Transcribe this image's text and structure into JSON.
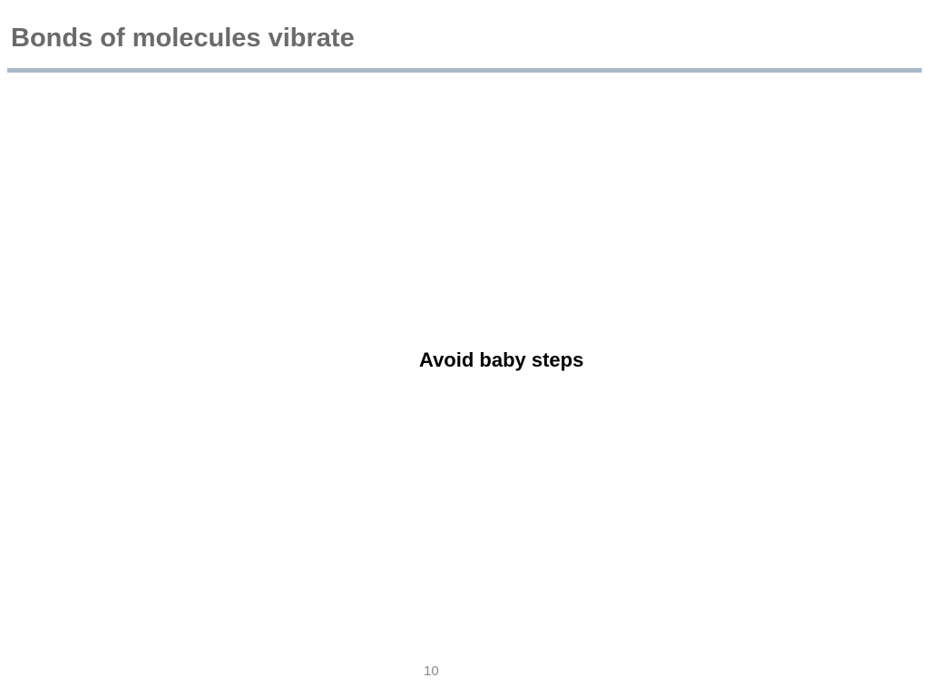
{
  "slide": {
    "title": "Bonds of molecules vibrate",
    "body_text": "Avoid baby steps",
    "page_number": "10"
  },
  "colors": {
    "title": "#6b6b6b",
    "rule": "#a9b8c9",
    "body_text": "#000000",
    "page_number": "#8a8a8a",
    "background": "#ffffff"
  }
}
